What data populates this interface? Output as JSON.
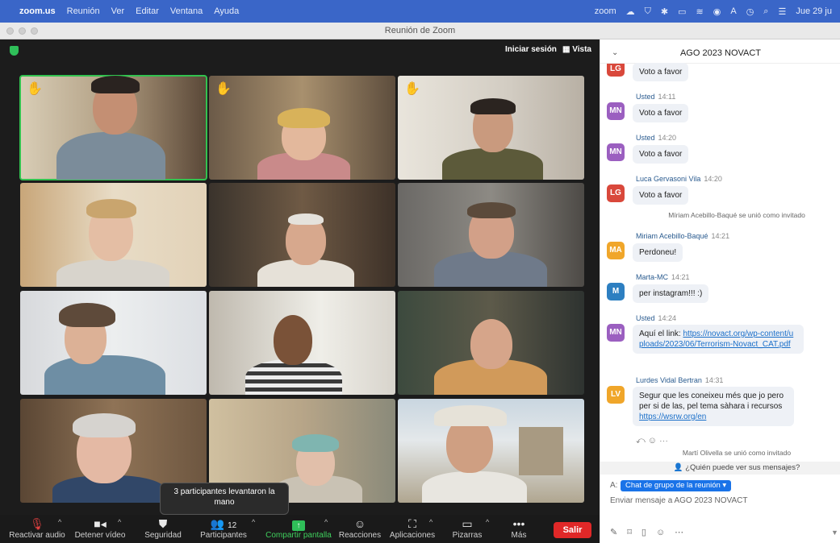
{
  "menubar": {
    "app": "zoom.us",
    "items": [
      "Reunión",
      "Ver",
      "Editar",
      "Ventana",
      "Ayuda"
    ],
    "status_app": "zoom",
    "date": "Jue 29 ju"
  },
  "window": {
    "title": "Reunión de Zoom"
  },
  "meeting": {
    "signin_label": "Iniciar sesión",
    "view_label": "Vista",
    "tooltip": "3 participantes levantaron la mano",
    "participant_count": "12"
  },
  "toolbar": {
    "audio_label": "Reactivar audio",
    "video_label": "Detener vídeo",
    "security_label": "Seguridad",
    "participants_label": "Participantes",
    "share_label": "Compartir pantalla",
    "reactions_label": "Reacciones",
    "apps_label": "Aplicaciones",
    "whiteboards_label": "Pizarras",
    "more_label": "Más",
    "leave_label": "Salir"
  },
  "chat": {
    "title": "AGO 2023 NOVACT",
    "messages": [
      {
        "initials": "LG",
        "author": "",
        "time": "",
        "text": "Voto a favor"
      },
      {
        "initials": "MN",
        "author": "Usted",
        "time": "14:11",
        "text": "Voto a favor"
      },
      {
        "initials": "MN",
        "author": "Usted",
        "time": "14:20",
        "text": "Voto a favor"
      },
      {
        "initials": "LG",
        "author": "Luca Gervasoni Vila",
        "time": "14:20",
        "text": "Voto a favor"
      },
      {
        "initials": "MA",
        "author": "Miriam Acebillo-Baqué",
        "time": "14:21",
        "text": "Perdoneu!"
      },
      {
        "initials": "M",
        "author": "Marta-MC",
        "time": "14:21",
        "text": "per instagram!!! :)"
      },
      {
        "initials": "MN",
        "author": "Usted",
        "time": "14:24",
        "text_prefix": "Aquí el link: ",
        "link": "https://novact.org/wp-content/uploads/2023/06/Terrorism-Novact_CAT.pdf"
      },
      {
        "initials": "LV",
        "author": "Lurdes Vidal Bertran",
        "time": "14:31",
        "text": "Segur que les coneixeu més que jo pero per si de las, pel tema sàhara i recursos",
        "link": "https://wsrw.org/en"
      }
    ],
    "system": [
      "Míriam Acebillo-Baqué se unió como invitado",
      "Martí Olivella se unió como invitado"
    ],
    "who_can_see": "¿Quién puede ver sus mensajes?",
    "to_label": "A:",
    "to_target": "Chat de grupo de la reunión",
    "compose_placeholder": "Enviar mensaje a AGO 2023 NOVACT"
  },
  "colors": {
    "active_speaker": "#32c24f",
    "leave": "#e02828",
    "share": "#2fbf59",
    "link": "#1a6fc9"
  }
}
